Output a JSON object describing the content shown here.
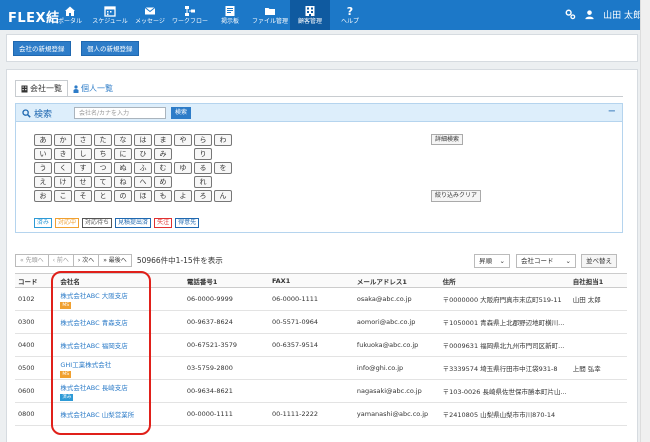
{
  "app": {
    "logo": "FLEX結"
  },
  "nav": [
    {
      "label": "ポータル",
      "icon": "home-icon"
    },
    {
      "label": "スケジュール",
      "icon": "calendar-icon"
    },
    {
      "label": "メッセージ",
      "icon": "mail-icon"
    },
    {
      "label": "ワークフロー",
      "icon": "workflow-icon"
    },
    {
      "label": "掲示板",
      "icon": "board-icon"
    },
    {
      "label": "ファイル管理",
      "icon": "folder-icon"
    },
    {
      "label": "顧客管理",
      "icon": "customer-icon"
    },
    {
      "label": "ヘルプ",
      "icon": "help-icon"
    }
  ],
  "user": {
    "name": "山田 太郎"
  },
  "actions": {
    "new_company": "会社の新規登録",
    "new_person": "個人の新規登録"
  },
  "tabs": {
    "company_list": "会社一覧",
    "person_list": "個人一覧"
  },
  "search": {
    "title": "検索",
    "placeholder": "会社名/カナを入力",
    "button": "検索",
    "detail": "詳細検索",
    "clear": "絞り込みクリア",
    "kana_rows": [
      [
        "あ",
        "か",
        "さ",
        "た",
        "な",
        "は",
        "ま",
        "や",
        "ら",
        "わ"
      ],
      [
        "い",
        "き",
        "し",
        "ち",
        "に",
        "ひ",
        "み",
        "",
        "り",
        ""
      ],
      [
        "う",
        "く",
        "す",
        "つ",
        "ぬ",
        "ふ",
        "む",
        "ゆ",
        "る",
        "を"
      ],
      [
        "え",
        "け",
        "せ",
        "て",
        "ね",
        "へ",
        "め",
        "",
        "れ",
        ""
      ],
      [
        "お",
        "こ",
        "そ",
        "と",
        "の",
        "ほ",
        "も",
        "よ",
        "ろ",
        "ん"
      ]
    ],
    "statuses": [
      {
        "label": "済み",
        "color": "#2d9ad6"
      },
      {
        "label": "対応中",
        "color": "#f0a030"
      },
      {
        "label": "対応待ち",
        "color": "#555555"
      },
      {
        "label": "見積提出済",
        "color": "#1f68b0"
      },
      {
        "label": "失注",
        "color": "#e03030"
      },
      {
        "label": "得意先",
        "color": "#1f68b0"
      }
    ]
  },
  "pager": {
    "first": "« 先頭へ",
    "prev": "‹ 前へ",
    "next": "› 次へ",
    "last": "» 最後へ",
    "summary": "50966件中1-15件を表示"
  },
  "sort": {
    "order": "昇順",
    "key": "会社コード",
    "button": "並べ替え"
  },
  "table": {
    "headers": [
      "コード",
      "会社名",
      "電話番号1",
      "FAX1",
      "メールアドレス1",
      "住所",
      "自社担当1"
    ],
    "rows": [
      {
        "code": "0102",
        "company": "株式会社ABC 大阪支店",
        "tag": "MS",
        "tag_color": "#f0a030",
        "tel": "06-0000-9999",
        "fax": "06-0000-1111",
        "email": "osaka@abc.co.jp",
        "address": "〒0000000 大阪府門真市末広町519-11",
        "owner": "山田 太郎"
      },
      {
        "code": "0300",
        "company": "株式会社ABC 青森支店",
        "tag": "",
        "tag_color": "",
        "tel": "00-9637-8624",
        "fax": "00-5571-0964",
        "email": "aomori@abc.co.jp",
        "address": "〒1050001 青森県上北郡野辺地町横川...",
        "owner": ""
      },
      {
        "code": "0400",
        "company": "株式会社ABC 福岡支店",
        "tag": "",
        "tag_color": "",
        "tel": "00-67521-3579",
        "fax": "00-6357-9514",
        "email": "fukuoka@abc.co.jp",
        "address": "〒0009631 福岡県北九州市門司区新町...",
        "owner": ""
      },
      {
        "code": "0500",
        "company": "GHI工業株式会社",
        "tag": "MS",
        "tag_color": "#f0a030",
        "tel": "03-5759-2800",
        "fax": "",
        "email": "info@ghi.co.jp",
        "address": "〒3339574 埼玉県行田市中江袋931-8",
        "owner": "上間 弘幸"
      },
      {
        "code": "0600",
        "company": "株式会社ABC 長崎支店",
        "tag": "済み",
        "tag_color": "#2d9ad6",
        "tel": "00-9634-8621",
        "fax": "",
        "email": "nagasaki@abc.co.jp",
        "address": "〒103-0026 長崎県佐世保市勝本町片山...",
        "owner": ""
      },
      {
        "code": "0800",
        "company": "株式会社ABC 山梨営業所",
        "tag": "",
        "tag_color": "",
        "tel": "00-0000-1111",
        "fax": "00-1111-2222",
        "email": "yamanashi@abc.co.jp",
        "address": "〒2410805 山梨県山梨市市川870-14",
        "owner": ""
      }
    ]
  },
  "colors": {
    "header": "#1c78c8",
    "accent": "#2d7cc8",
    "highlight": "#e0201a"
  }
}
